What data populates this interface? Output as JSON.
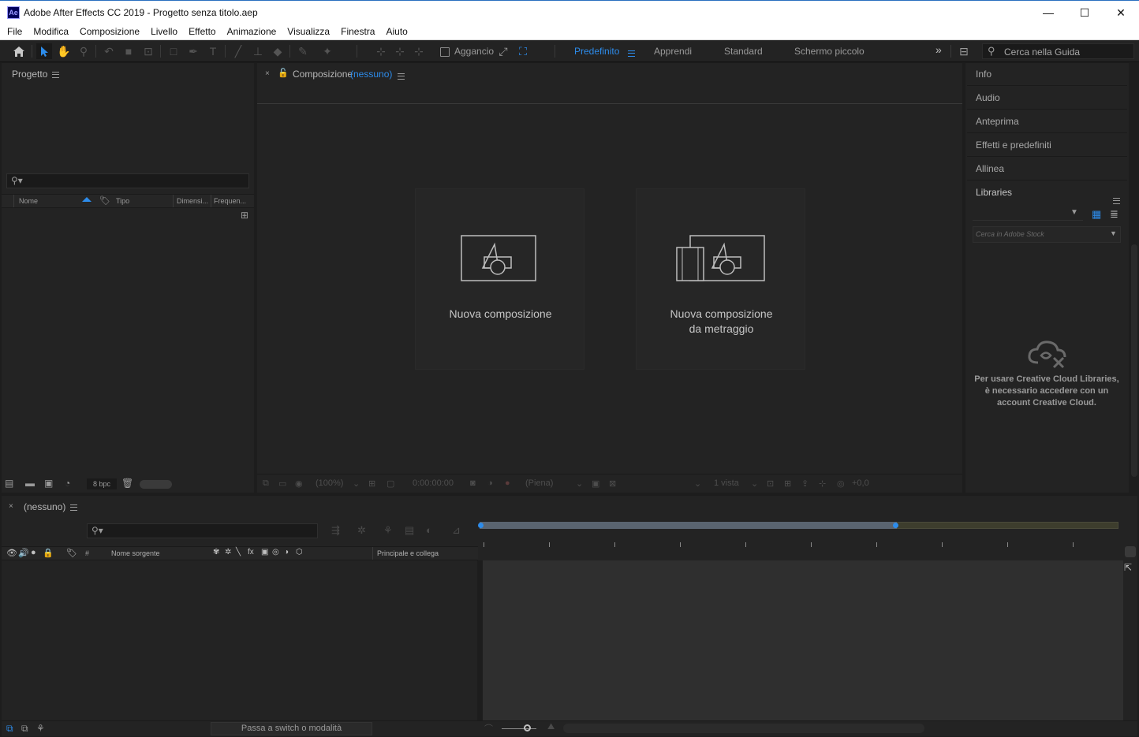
{
  "window": {
    "app_icon_text": "Ae",
    "title": "Adobe After Effects CC 2019 - Progetto senza titolo.aep",
    "minimize": "—",
    "maximize": "☐",
    "close": "✕"
  },
  "menu": [
    "File",
    "Modifica",
    "Composizione",
    "Livello",
    "Effetto",
    "Animazione",
    "Visualizza",
    "Finestra",
    "Aiuto"
  ],
  "toolbar": {
    "snap_label": "Aggancio",
    "workspaces": [
      "Predefinito",
      "Apprendi",
      "Standard",
      "Schermo piccolo"
    ],
    "active_workspace": "Predefinito",
    "more": "»",
    "help_search_placeholder": "Cerca nella Guida"
  },
  "project_panel": {
    "title": "Progetto",
    "columns": [
      "Nome",
      "Tipo",
      "Dimensi...",
      "Frequen..."
    ],
    "bpc_label": "8 bpc"
  },
  "composition_panel": {
    "tab_label": "Composizione",
    "tab_value": "(nessuno)",
    "new_comp": "Nuova composizione",
    "new_comp_footage_line1": "Nuova composizione",
    "new_comp_footage_line2": "da metraggio",
    "zoom": "(100%)",
    "timecode": "0:00:00:00",
    "resolution": "(Piena)",
    "views": "1 vista",
    "exposure": "+0,0"
  },
  "right_panel": {
    "items": [
      "Info",
      "Audio",
      "Anteprima",
      "Effetti e predefiniti",
      "Allinea"
    ],
    "libraries_title": "Libraries",
    "stock_search_placeholder": "Cerca in Adobe Stock",
    "cc_message": "Per usare Creative Cloud Libraries, è necessario accedere con un account Creative Cloud."
  },
  "timeline_panel": {
    "tab_label": "(nessuno)",
    "col_source": "Nome sorgente",
    "col_parent": "Principale e collega",
    "col_num": "#",
    "toggle_label": "Passa a switch o modalità"
  },
  "colors": {
    "accent": "#2d8ceb",
    "panel_bg": "#232323",
    "frame_bg": "#1d1d1d",
    "titlebar_bg": "#ffffff"
  }
}
